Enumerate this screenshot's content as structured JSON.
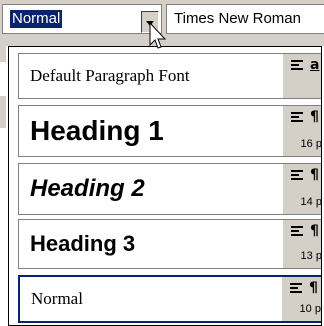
{
  "toolbar": {
    "style_value": "Normal",
    "font_value": "Times New Roman"
  },
  "style_list": [
    {
      "label": "Default Paragraph Font",
      "kind_glyph": "a",
      "size": "",
      "alignment_icon": "align-left-icon",
      "kind_icon": "character-style-icon"
    },
    {
      "label": "Heading 1",
      "kind_glyph": "¶",
      "size": "16 pt",
      "alignment_icon": "align-left-icon",
      "kind_icon": "paragraph-mark-icon"
    },
    {
      "label": "Heading 2",
      "kind_glyph": "¶",
      "size": "14 pt",
      "alignment_icon": "align-left-icon",
      "kind_icon": "paragraph-mark-icon"
    },
    {
      "label": "Heading 3",
      "kind_glyph": "¶",
      "size": "13 pt",
      "alignment_icon": "align-left-icon",
      "kind_icon": "paragraph-mark-icon"
    },
    {
      "label": "Normal",
      "kind_glyph": "¶",
      "size": "10 pt",
      "alignment_icon": "align-left-icon",
      "kind_icon": "paragraph-mark-icon",
      "selected": true
    }
  ],
  "colors": {
    "selection": "#0a246a",
    "panel_gray": "#d4d0c8",
    "text": "#000000",
    "background": "#ffffff"
  }
}
